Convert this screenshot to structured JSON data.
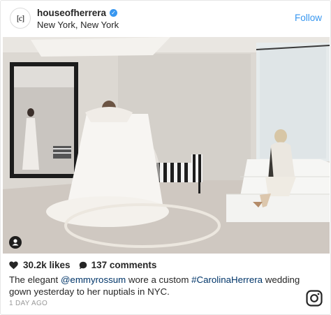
{
  "header": {
    "avatar_mark": "[c]",
    "username": "houseofherrera",
    "location": "New York, New York",
    "follow_label": "Follow"
  },
  "stats": {
    "likes": "30.2k likes",
    "comments": "137 comments"
  },
  "caption": {
    "pre": "The elegant ",
    "mention": "@emmyrossum",
    "mid": " wore a custom ",
    "hashtag": "#CarolinaHerrera",
    "post": " wedding gown yesterday to her nuptials in NYC."
  },
  "timestamp": "1 DAY AGO",
  "colors": {
    "link": "#003569",
    "accent": "#3897f0"
  },
  "icons": [
    "verified-badge-icon",
    "user-tag-icon",
    "heart-icon",
    "comment-bubble-icon",
    "instagram-logo-icon"
  ]
}
